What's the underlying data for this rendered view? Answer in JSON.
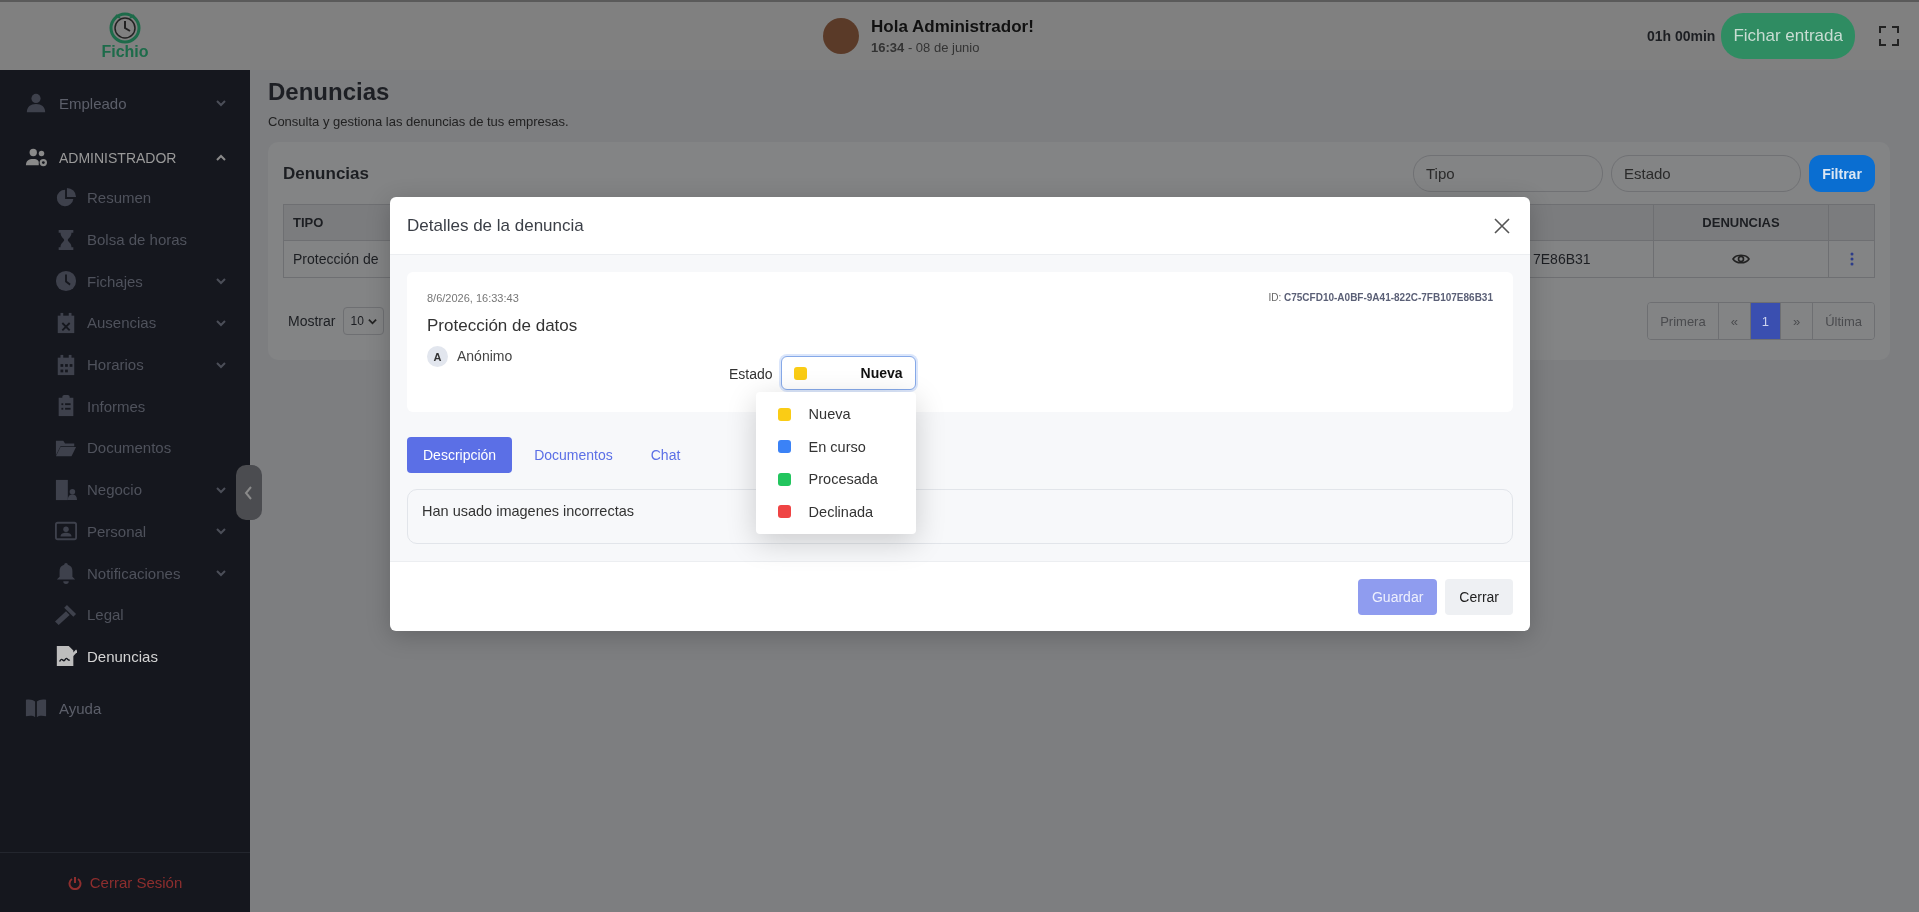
{
  "topbar": {
    "logo_text": "Fichio",
    "greeting": "Hola Administrador!",
    "datetime": "**16:34** - 08 de junio",
    "timer": "01h 00min",
    "clock_in_button": "Fichar entrada"
  },
  "sidebar": {
    "items": [
      {
        "label": "Empleado",
        "expanded": false,
        "selected": false
      },
      {
        "label": "ADMINISTRADOR",
        "expanded": true,
        "selected": false,
        "children": [
          {
            "label": "Resumen",
            "selected": false
          },
          {
            "label": "Bolsa de horas",
            "selected": false
          },
          {
            "label": "Fichajes",
            "expanded": false,
            "selected": false
          },
          {
            "label": "Ausencias",
            "expanded": false,
            "selected": false
          },
          {
            "label": "Horarios",
            "expanded": false,
            "selected": false
          },
          {
            "label": "Informes",
            "selected": false
          },
          {
            "label": "Documentos",
            "selected": false
          },
          {
            "label": "Negocio",
            "expanded": false,
            "selected": false
          },
          {
            "label": "Personal",
            "expanded": false,
            "selected": false
          },
          {
            "label": "Notificaciones",
            "expanded": false,
            "selected": false
          },
          {
            "label": "Legal",
            "selected": false
          },
          {
            "label": "Denuncias",
            "selected": true
          }
        ]
      },
      {
        "label": "Ayuda",
        "selected": false
      }
    ],
    "logout": "Cerrar Sesión"
  },
  "page": {
    "title": "Denuncias",
    "subtitle": "Consulta y gestiona las denuncias de tus empresas."
  },
  "card": {
    "title": "Denuncias",
    "filters": [
      {
        "placeholder": "Tipo"
      },
      {
        "placeholder": "Estado"
      }
    ],
    "filter_button": "Filtrar",
    "table": {
      "columns": {
        "tipo": "TIPO",
        "denuncias": "DENUNCIAS"
      },
      "rows": [
        {
          "tipo": "Protección de",
          "column_3": "7E86B31"
        }
      ]
    },
    "show_label": "Mostrar",
    "page_size": "10",
    "pagination": [
      {
        "label": "Primera",
        "selected": false,
        "disabled": true
      },
      {
        "label": "«",
        "selected": false,
        "disabled": true
      },
      {
        "label": "1",
        "selected": true,
        "disabled": false
      },
      {
        "label": "»",
        "selected": false,
        "disabled": true
      },
      {
        "label": "Última",
        "selected": false,
        "disabled": true
      }
    ]
  },
  "modal": {
    "title": "Detalles de la denuncia",
    "date": "8/6/2026, 16:33:43",
    "id": "ID: **C75CFD10-A0BF-9A41-822C-7FB107E86B31**",
    "name": "Protección de datos",
    "author_initial": "A",
    "author": "Anónimo",
    "status_label": "Estado",
    "status": {
      "label": "Nueva",
      "color": "#facc15"
    },
    "status_options": [
      {
        "label": "Nueva",
        "color": "#facc15"
      },
      {
        "label": "En curso",
        "color": "#3b82f6"
      },
      {
        "label": "Procesada",
        "color": "#22c55e"
      },
      {
        "label": "Declinada",
        "color": "#ef4444"
      }
    ],
    "tabs": [
      {
        "label": "Descripción",
        "selected": true
      },
      {
        "label": "Documentos",
        "selected": false
      },
      {
        "label": "Chat",
        "selected": false
      }
    ],
    "description": "Han usado imagenes incorrectas",
    "buttons": [
      {
        "label": "Guardar",
        "kind": "primary",
        "disabled": true
      },
      {
        "label": "Cerrar",
        "kind": "secondary",
        "disabled": false
      }
    ]
  }
}
